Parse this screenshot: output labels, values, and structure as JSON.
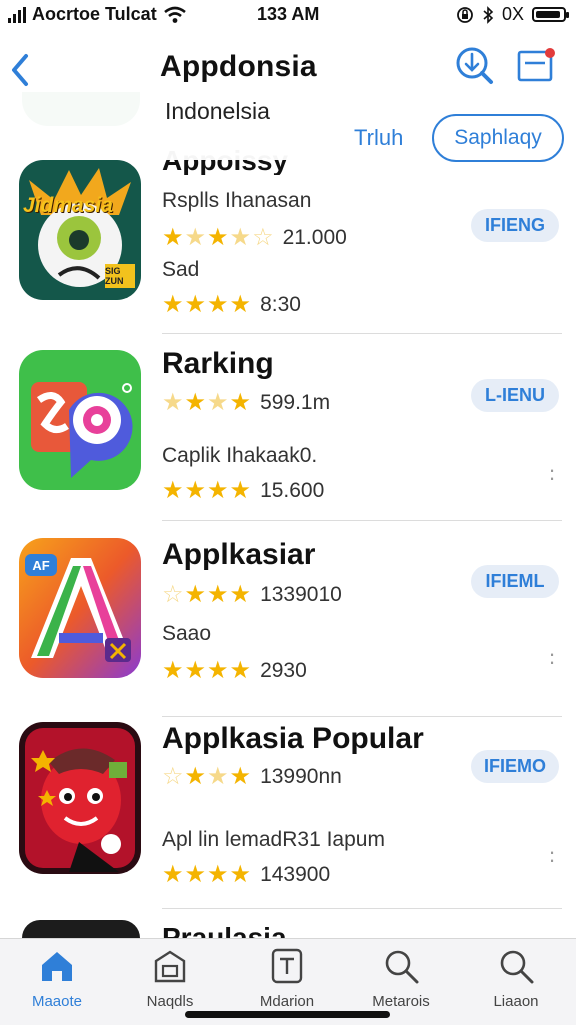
{
  "status": {
    "carrier": "Aocrtoe Tulcat",
    "time": "133 AM",
    "battery_text": "0X",
    "icons": [
      "signal-icon",
      "wifi-icon",
      "lock-rotation-icon",
      "bluetooth-icon",
      "battery-icon"
    ]
  },
  "header": {
    "title": "Appdonsia",
    "subtitle": "Indonelsia",
    "link": "Trluh",
    "chip": "Saphlaqy",
    "icons": [
      "back-chevron-icon",
      "download-search-icon",
      "inbox-icon"
    ]
  },
  "partial_top_name": "Appoissy",
  "apps": [
    {
      "name": "",
      "line1": "Rsplls Ihanasan",
      "rating1": "21.000",
      "line2": "Sad",
      "rating2": "8:30",
      "button": "IFIENG",
      "icon_text": "Jidmasia",
      "icon_badge": "SIG ZUN"
    },
    {
      "name": "Rarking",
      "rating1": "599.1m",
      "line2": "Caplik Ihakaak0.",
      "rating2": "15.600",
      "button": "L-IENU"
    },
    {
      "name": "Applkasiar",
      "rating1": "1339010",
      "line2": "Saao",
      "rating2": "2930",
      "button": "IFIEML",
      "icon_badge": "AF"
    },
    {
      "name": "Applkasia Popular",
      "rating1": "13990nn",
      "line2": "Apl lin lemadR31 Iapum",
      "rating2": "143900",
      "button": "IFIEMO"
    }
  ],
  "partial_bottom_name": "Praulasia",
  "tabs": [
    {
      "label": "Maaote",
      "icon": "home-icon",
      "active": true
    },
    {
      "label": "Naqdls",
      "icon": "store-icon",
      "active": false
    },
    {
      "label": "Mdarion",
      "icon": "tablet-icon",
      "active": false
    },
    {
      "label": "Metarois",
      "icon": "search-icon",
      "active": false
    },
    {
      "label": "Liaaon",
      "icon": "search-icon",
      "active": false
    }
  ],
  "colors": {
    "accent": "#2f7fd8",
    "star": "#f4b400",
    "badge": "#e23b3b"
  }
}
